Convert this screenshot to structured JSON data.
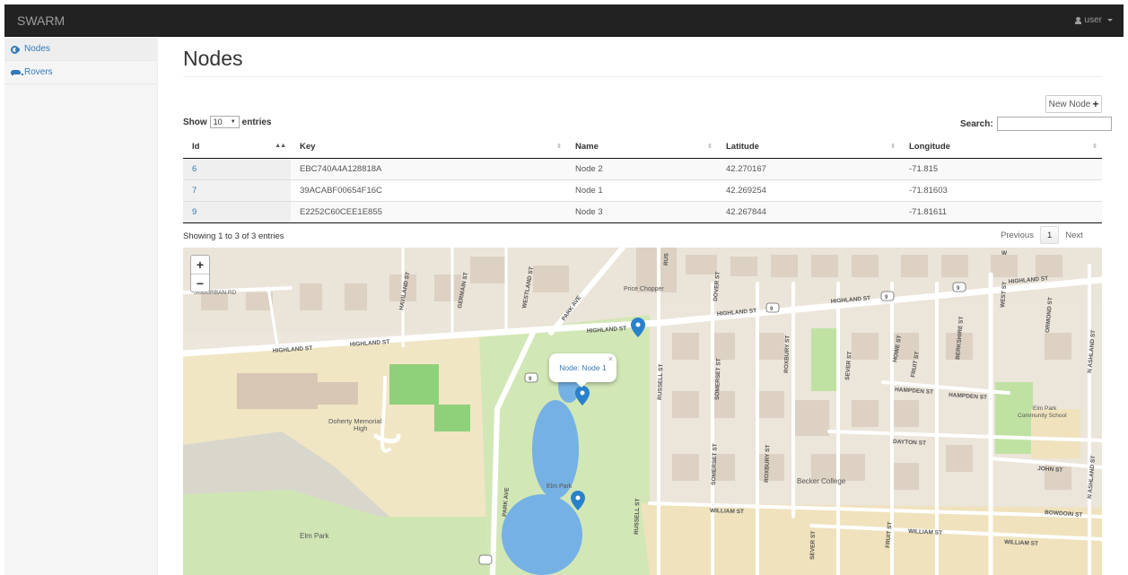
{
  "navbar": {
    "brand": "SWARM",
    "user": "user"
  },
  "sidebar": {
    "items": [
      {
        "label": "Nodes",
        "icon": "nodes-icon"
      },
      {
        "label": "Rovers",
        "icon": "car-icon"
      }
    ]
  },
  "page": {
    "title": "Nodes",
    "new_button": "New Node"
  },
  "table": {
    "length_label_before": "Show",
    "length_value": "10",
    "length_label_after": "entries",
    "search_label": "Search:",
    "search_value": "",
    "columns": [
      "Id",
      "Key",
      "Name",
      "Latitude",
      "Longitude"
    ],
    "rows": [
      {
        "id": "6",
        "key": "EBC740A4A128818A",
        "name": "Node 2",
        "lat": "42.270167",
        "lng": "-71.815"
      },
      {
        "id": "7",
        "key": "39ACABF00654F16C",
        "name": "Node 1",
        "lat": "42.269254",
        "lng": "-71.81603"
      },
      {
        "id": "9",
        "key": "E2252C60CEE1E855",
        "name": "Node 3",
        "lat": "42.267844",
        "lng": "-71.81611"
      }
    ],
    "info": "Showing 1 to 3 of 3 entries",
    "pager": {
      "previous": "Previous",
      "current": "1",
      "next": "Next"
    }
  },
  "map": {
    "zoom_in": "+",
    "zoom_out": "−",
    "popup_text": "Node: Node 1",
    "popup_close": "×",
    "labels": {
      "suburban": "SUBURBAN RD",
      "haviland": "HAVILAND ST",
      "germain": "GERMAIN ST",
      "westland": "WESTLAND ST",
      "park_ave": "PARK AVE",
      "price_chopper": "Price Chopper",
      "dover": "DOVER ST",
      "highland_w": "HIGHLAND ST",
      "highland_w2": "HIGHLAND ST",
      "highland_mid": "HIGHLAND ST",
      "highland_c": "HIGHLAND ST",
      "highland_e": "HIGHLAND ST",
      "highland_far": "HIGHLAND ST",
      "west_st": "WEST ST",
      "ormond": "ORMOND ST",
      "n_ashland": "N ASHLAND ST",
      "n_ashland2": "N ASHLAND ST",
      "russell": "RUSSELL ST",
      "russell2": "RUSSELL ST",
      "somerset": "SOMERSET ST",
      "somerset2": "SOMERSET ST",
      "roxbury": "ROXBURY ST",
      "roxbury2": "ROXBURY ST",
      "sever": "SEVER ST",
      "sever2": "SEVER ST",
      "howe": "HOWE ST",
      "fruit": "FRUIT ST",
      "fruit2": "FRUIT ST",
      "berkshire": "BERKSHIRE ST",
      "hampden": "HAMPDEN ST",
      "hampden2": "HAMPDEN ST",
      "elm_park_school": "Elm Park",
      "elm_park_school2": "Community School",
      "dayton": "DAYTON ST",
      "john": "JOHN ST",
      "becker": "Becker College",
      "william": "WILLIAM ST",
      "william2": "WILLIAM ST",
      "william3": "WILLIAM ST",
      "bowdoin": "BOWDOIN ST",
      "doherty": "Doherty Memorial",
      "doherty2": "High",
      "elm_park": "Elm Park",
      "elm_park_pond": "Elm Park",
      "park_ave2": "PARK AVE",
      "rt9a": "9",
      "rt9b": "9",
      "rt9c": "9",
      "rt9d": "9",
      "rus": "RUS",
      "w_top": "W"
    }
  }
}
